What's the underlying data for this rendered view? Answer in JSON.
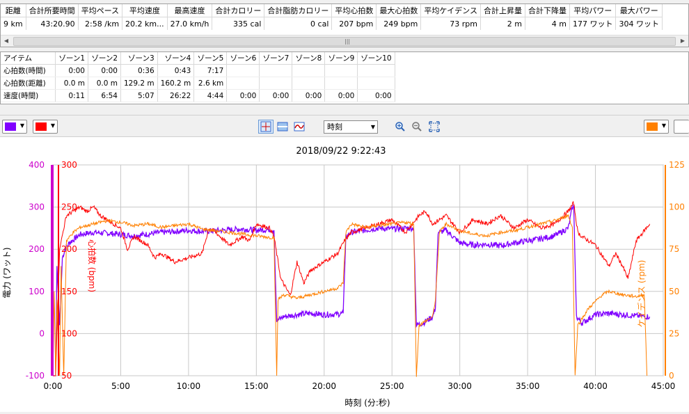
{
  "summary": {
    "headers": [
      "距離",
      "合計所要時間",
      "平均ペース",
      "平均速度",
      "最高速度",
      "合計カロリー",
      "合計脂肪カロリー",
      "平均心拍数",
      "最大心拍数",
      "平均ケイデンス",
      "合計上昇量",
      "合計下降量",
      "平均パワー",
      "最大パワー"
    ],
    "values": [
      "9 km",
      "43:20.90",
      "2:58 /km",
      "20.2 km...",
      "27.0 km/h",
      "335 cal",
      "0 cal",
      "207 bpm",
      "249 bpm",
      "73 rpm",
      "2 m",
      "4 m",
      "177 ワット",
      "304 ワット"
    ]
  },
  "zones": {
    "headers": [
      "アイテム",
      "ゾーン1",
      "ゾーン2",
      "ゾーン3",
      "ゾーン4",
      "ゾーン5",
      "ゾーン6",
      "ゾーン7",
      "ゾーン8",
      "ゾーン9",
      "ゾーン10"
    ],
    "rows": [
      [
        "心拍数(時間)",
        "0:00",
        "0:00",
        "0:36",
        "0:43",
        "7:17",
        "",
        "",
        "",
        "",
        ""
      ],
      [
        "心拍数(距離)",
        "0.0 m",
        "0.0 m",
        "129.2 m",
        "160.2 m",
        "2.6 km",
        "",
        "",
        "",
        "",
        ""
      ],
      [
        "速度(時間)",
        "0:11",
        "6:54",
        "5:07",
        "26:22",
        "4:44",
        "0:00",
        "0:00",
        "0:00",
        "0:00",
        "0:00"
      ]
    ]
  },
  "toolbar": {
    "time_mode": "時刻"
  },
  "colors": {
    "power": "#8000ff",
    "heart_rate": "#ff0000",
    "cadence": "#ff8000"
  },
  "chart_data": {
    "type": "line",
    "title": "2018/09/22 9:22:43",
    "xlabel": "時刻 (分:秒)",
    "x_ticks": [
      "0:00",
      "5:00",
      "10:00",
      "15:00",
      "20:00",
      "25:00",
      "30:00",
      "35:00",
      "40:00",
      "45:00"
    ],
    "xlim_minutes": [
      0,
      45
    ],
    "axes": [
      {
        "label": "電力 (ワット)",
        "color": "#cc00cc",
        "range": [
          -100,
          400
        ],
        "ticks": [
          "400",
          "300",
          "200",
          "100",
          "0",
          "-100"
        ]
      },
      {
        "label": "心拍数 (bpm)",
        "color": "#ff0000",
        "range": [
          50,
          300
        ],
        "ticks": [
          "300",
          "250",
          "200",
          "150",
          "100",
          "50"
        ]
      },
      {
        "label": "ケイデンス (rpm)",
        "color": "#ff8000",
        "range": [
          0,
          125
        ],
        "ticks": [
          "125",
          "100",
          "75",
          "50",
          "25",
          "0"
        ]
      }
    ],
    "series": [
      {
        "axis": 0,
        "color": "#8000ff",
        "points": [
          [
            0,
            -100
          ],
          [
            0.2,
            -100
          ],
          [
            0.3,
            160
          ],
          [
            0.5,
            20
          ],
          [
            0.7,
            180
          ],
          [
            0.9,
            200
          ],
          [
            1.2,
            215
          ],
          [
            1.6,
            225
          ],
          [
            2,
            235
          ],
          [
            3,
            240
          ],
          [
            4,
            238
          ],
          [
            5,
            235
          ],
          [
            6,
            232
          ],
          [
            7,
            236
          ],
          [
            8,
            240
          ],
          [
            9,
            242
          ],
          [
            10,
            245
          ],
          [
            11,
            242
          ],
          [
            12,
            244
          ],
          [
            13,
            246
          ],
          [
            14,
            248
          ],
          [
            15,
            245
          ],
          [
            16,
            247
          ],
          [
            16.3,
            245
          ],
          [
            16.5,
            30
          ],
          [
            17,
            40
          ],
          [
            18,
            45
          ],
          [
            19,
            48
          ],
          [
            20,
            45
          ],
          [
            21,
            46
          ],
          [
            21.4,
            48
          ],
          [
            21.6,
            230
          ],
          [
            22,
            240
          ],
          [
            23,
            245
          ],
          [
            24,
            250
          ],
          [
            25,
            248
          ],
          [
            26,
            250
          ],
          [
            26.6,
            250
          ],
          [
            26.8,
            20
          ],
          [
            27.3,
            25
          ],
          [
            28,
            40
          ],
          [
            28.2,
            60
          ],
          [
            28.4,
            240
          ],
          [
            29,
            245
          ],
          [
            29.5,
            230
          ],
          [
            30,
            215
          ],
          [
            31,
            210
          ],
          [
            32,
            212
          ],
          [
            33,
            208
          ],
          [
            34,
            215
          ],
          [
            35,
            220
          ],
          [
            36,
            225
          ],
          [
            37,
            232
          ],
          [
            38,
            250
          ],
          [
            38.3,
            300
          ],
          [
            38.4,
            300
          ],
          [
            38.6,
            40
          ],
          [
            39,
            25
          ],
          [
            40,
            45
          ],
          [
            41,
            48
          ],
          [
            42,
            45
          ],
          [
            43,
            42
          ],
          [
            44,
            40
          ]
        ]
      },
      {
        "axis": 1,
        "color": "#ff0000",
        "points": [
          [
            0,
            50
          ],
          [
            0.2,
            50
          ],
          [
            0.3,
            100
          ],
          [
            0.5,
            200
          ],
          [
            0.8,
            225
          ],
          [
            1,
            240
          ],
          [
            1.5,
            245
          ],
          [
            2,
            250
          ],
          [
            2.5,
            245
          ],
          [
            3,
            250
          ],
          [
            3.5,
            240
          ],
          [
            4,
            235
          ],
          [
            5,
            225
          ],
          [
            5.5,
            200
          ],
          [
            6,
            215
          ],
          [
            7,
            205
          ],
          [
            7.5,
            190
          ],
          [
            8,
            195
          ],
          [
            9,
            185
          ],
          [
            10,
            190
          ],
          [
            11,
            195
          ],
          [
            11.5,
            225
          ],
          [
            12,
            220
          ],
          [
            13,
            205
          ],
          [
            14,
            215
          ],
          [
            14.5,
            210
          ],
          [
            15,
            230
          ],
          [
            16,
            225
          ],
          [
            16.3,
            215
          ],
          [
            16.8,
            165
          ],
          [
            17.5,
            145
          ],
          [
            18,
            185
          ],
          [
            18.5,
            160
          ],
          [
            19,
            175
          ],
          [
            20,
            185
          ],
          [
            21,
            195
          ],
          [
            21.5,
            210
          ],
          [
            22,
            220
          ],
          [
            23,
            225
          ],
          [
            24,
            230
          ],
          [
            25,
            235
          ],
          [
            26,
            220
          ],
          [
            27,
            240
          ],
          [
            27.5,
            245
          ],
          [
            28,
            230
          ],
          [
            29,
            240
          ],
          [
            30,
            220
          ],
          [
            31,
            235
          ],
          [
            32,
            230
          ],
          [
            33,
            240
          ],
          [
            34,
            225
          ],
          [
            35,
            235
          ],
          [
            36,
            225
          ],
          [
            37,
            230
          ],
          [
            38,
            245
          ],
          [
            38.4,
            255
          ],
          [
            38.7,
            220
          ],
          [
            39,
            215
          ],
          [
            40,
            205
          ],
          [
            41,
            180
          ],
          [
            41.5,
            195
          ],
          [
            42,
            180
          ],
          [
            42.4,
            165
          ],
          [
            43,
            210
          ],
          [
            44,
            230
          ]
        ]
      },
      {
        "axis": 2,
        "color": "#ff8000",
        "points": [
          [
            0,
            0
          ],
          [
            0.1,
            50
          ],
          [
            0.2,
            0
          ],
          [
            0.3,
            45
          ],
          [
            0.5,
            0
          ],
          [
            0.6,
            65
          ],
          [
            0.8,
            0
          ],
          [
            1,
            80
          ],
          [
            1.5,
            85
          ],
          [
            2,
            88
          ],
          [
            3,
            90
          ],
          [
            4,
            92
          ],
          [
            5,
            91
          ],
          [
            6,
            89
          ],
          [
            7,
            90
          ],
          [
            8,
            88
          ],
          [
            9,
            89
          ],
          [
            10,
            90
          ],
          [
            11,
            87
          ],
          [
            12,
            86
          ],
          [
            13,
            85
          ],
          [
            14,
            84
          ],
          [
            15,
            83
          ],
          [
            16,
            82
          ],
          [
            16.3,
            82
          ],
          [
            16.5,
            0
          ],
          [
            16.6,
            45
          ],
          [
            17,
            48
          ],
          [
            18,
            46
          ],
          [
            19,
            48
          ],
          [
            20,
            50
          ],
          [
            21,
            52
          ],
          [
            21.4,
            55
          ],
          [
            21.6,
            85
          ],
          [
            22,
            90
          ],
          [
            23,
            88
          ],
          [
            24,
            89
          ],
          [
            25,
            90
          ],
          [
            26,
            91
          ],
          [
            26.6,
            90
          ],
          [
            26.8,
            0
          ],
          [
            27,
            30
          ],
          [
            28,
            35
          ],
          [
            28.2,
            45
          ],
          [
            28.5,
            85
          ],
          [
            29,
            90
          ],
          [
            30,
            86
          ],
          [
            31,
            84
          ],
          [
            32,
            83
          ],
          [
            33,
            85
          ],
          [
            34,
            86
          ],
          [
            35,
            88
          ],
          [
            36,
            90
          ],
          [
            37,
            92
          ],
          [
            38,
            95
          ],
          [
            38.3,
            88
          ],
          [
            38.5,
            0
          ],
          [
            38.7,
            30
          ],
          [
            39.5,
            40
          ],
          [
            40.5,
            48
          ],
          [
            41,
            50
          ],
          [
            42,
            48
          ],
          [
            43,
            47
          ],
          [
            43.6,
            48
          ],
          [
            43.8,
            0
          ]
        ]
      }
    ]
  }
}
